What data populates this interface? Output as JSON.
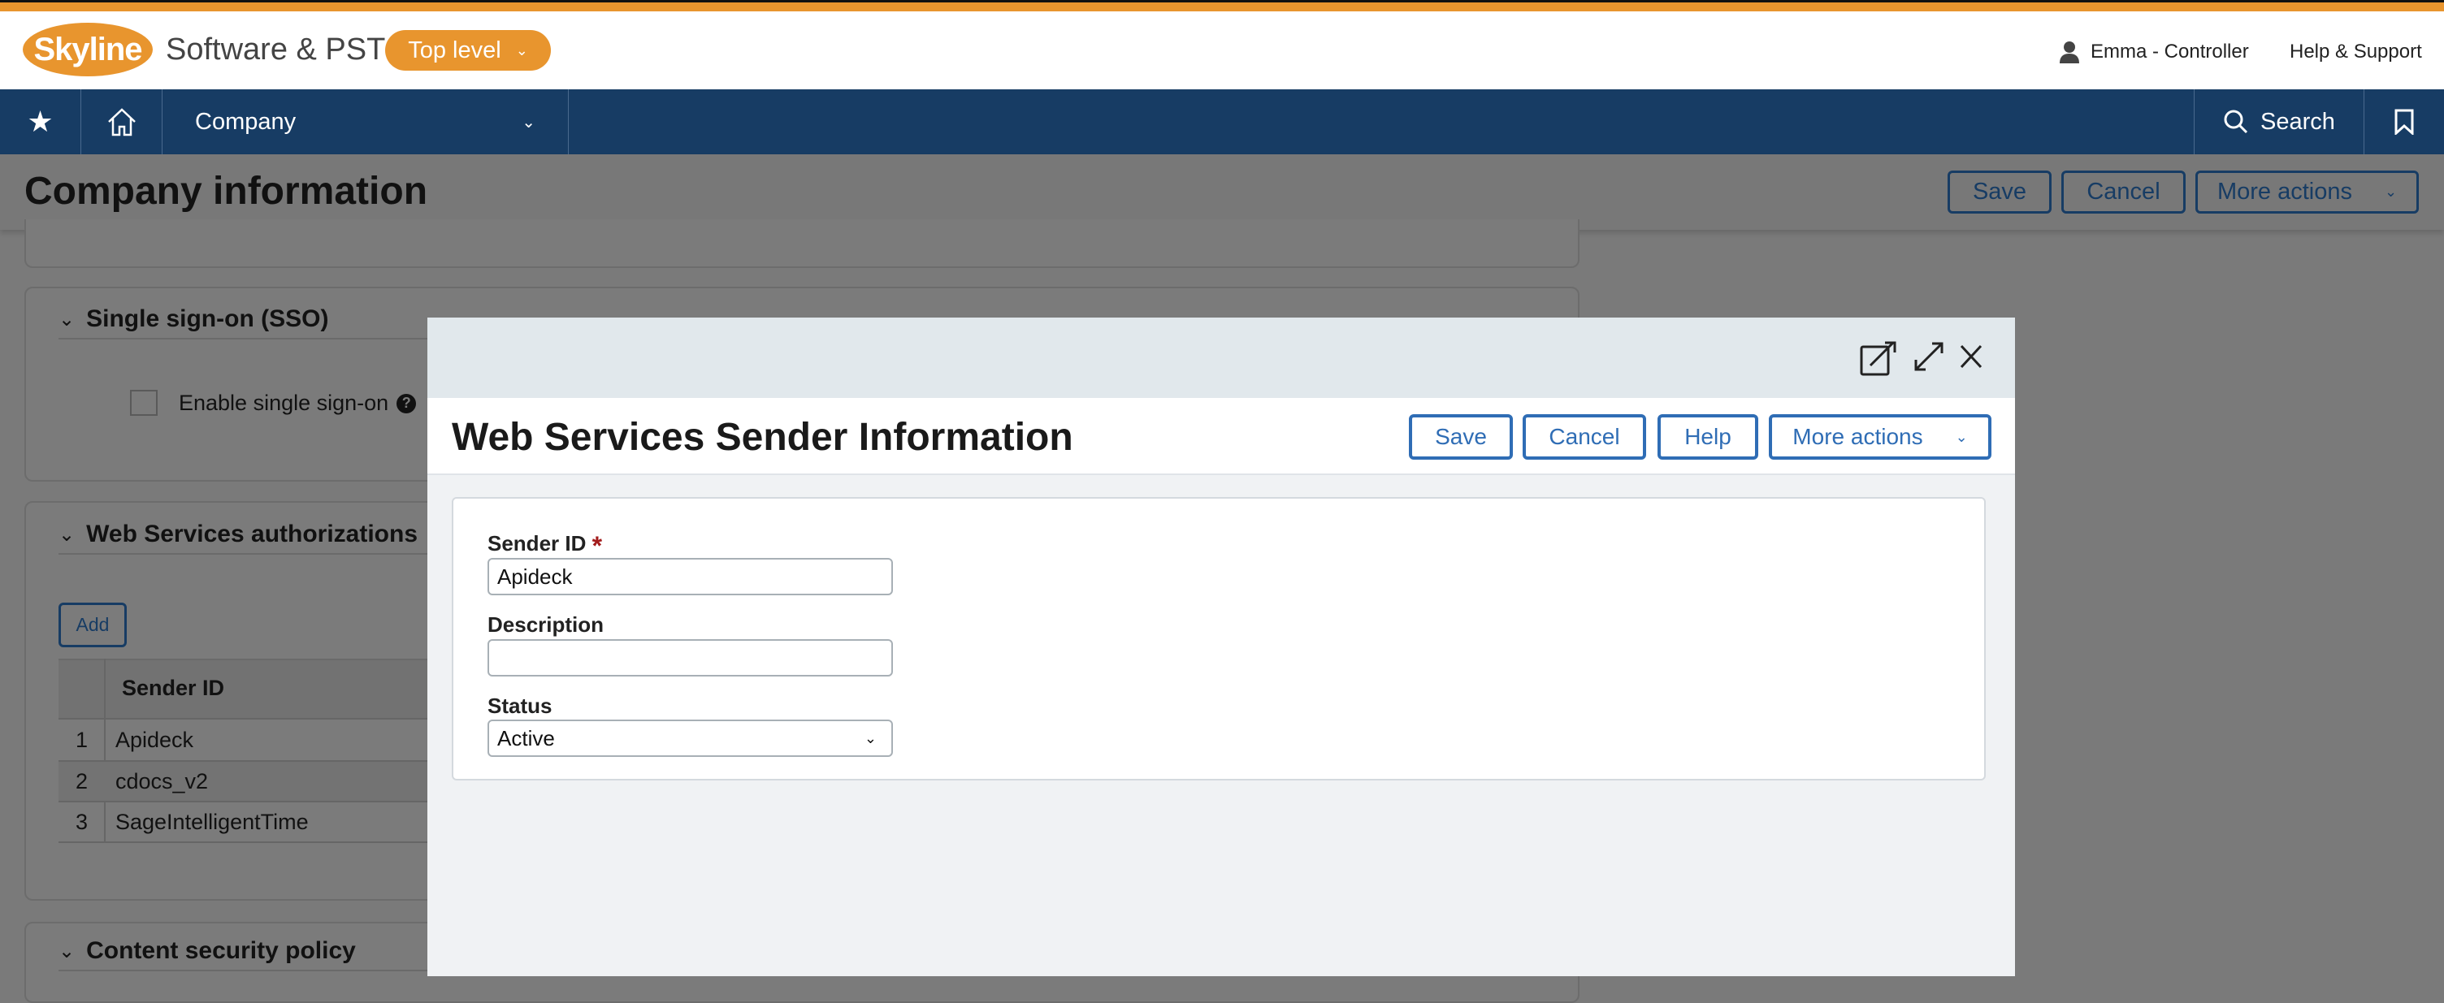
{
  "header": {
    "logo": "Skyline",
    "app_name": "Software & PST",
    "entity_button": "Top level",
    "user": "Emma - Controller",
    "help": "Help & Support"
  },
  "nav": {
    "module": "Company",
    "search": "Search"
  },
  "page": {
    "title": "Company information",
    "save": "Save",
    "cancel": "Cancel",
    "more_actions": "More actions"
  },
  "sso": {
    "title": "Single sign-on (SSO)",
    "enable_label": "Enable single sign-on",
    "enabled": false
  },
  "ws": {
    "title": "Web Services authorizations",
    "add": "Add",
    "column": "Sender ID",
    "rows": [
      {
        "n": "1",
        "id": "Apideck"
      },
      {
        "n": "2",
        "id": "cdocs_v2"
      },
      {
        "n": "3",
        "id": "SageIntelligentTime"
      }
    ]
  },
  "csp": {
    "title": "Content security policy"
  },
  "modal": {
    "title": "Web Services Sender Information",
    "save": "Save",
    "cancel": "Cancel",
    "help": "Help",
    "more_actions": "More actions",
    "sender_id_label": "Sender ID",
    "required": "*",
    "sender_id_value": "Apideck",
    "description_label": "Description",
    "description_value": "",
    "status_label": "Status",
    "status_value": "Active"
  },
  "colors": {
    "brand_orange": "#e8952e",
    "nav_blue": "#173c64",
    "link_blue": "#2f6db5",
    "required_red": "#a31c1c"
  }
}
